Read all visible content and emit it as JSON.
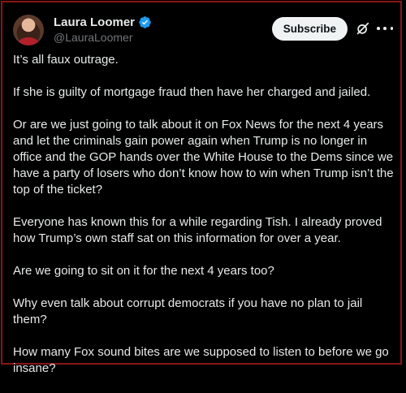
{
  "author": {
    "display_name": "Laura Loomer",
    "handle": "@LauraLoomer",
    "avatar_icon": "profile-photo",
    "verified_icon": "verified-badge-icon",
    "verified_color": "#1d9bf0"
  },
  "actions": {
    "subscribe_label": "Subscribe",
    "grok_icon": "grok-icon",
    "more_icon": "more-dots-icon"
  },
  "post": {
    "paragraphs": [
      "It’s all faux outrage.",
      "If she is guilty of mortgage fraud then have her charged and jailed.",
      "Or are we just going to talk about it on Fox News for the next 4 years and let the criminals gain power again when Trump is no longer in office and the GOP hands over the White House to the Dems since we have a party of losers who don’t know how to win when Trump isn’t the top of the ticket?",
      "Everyone has known this for a while regarding Tish. I already proved how Trump’s own staff sat on this information for over a year.",
      "Are we going to sit on it for the next 4 years too?",
      "Why even talk about corrupt democrats if you have no plan to jail them?",
      "How many Fox sound bites are we supposed to listen to before we go insane?"
    ]
  },
  "colors": {
    "background": "#000000",
    "text": "#e7e9ea",
    "secondary_text": "#71767b",
    "frame_border": "#8a1616"
  }
}
